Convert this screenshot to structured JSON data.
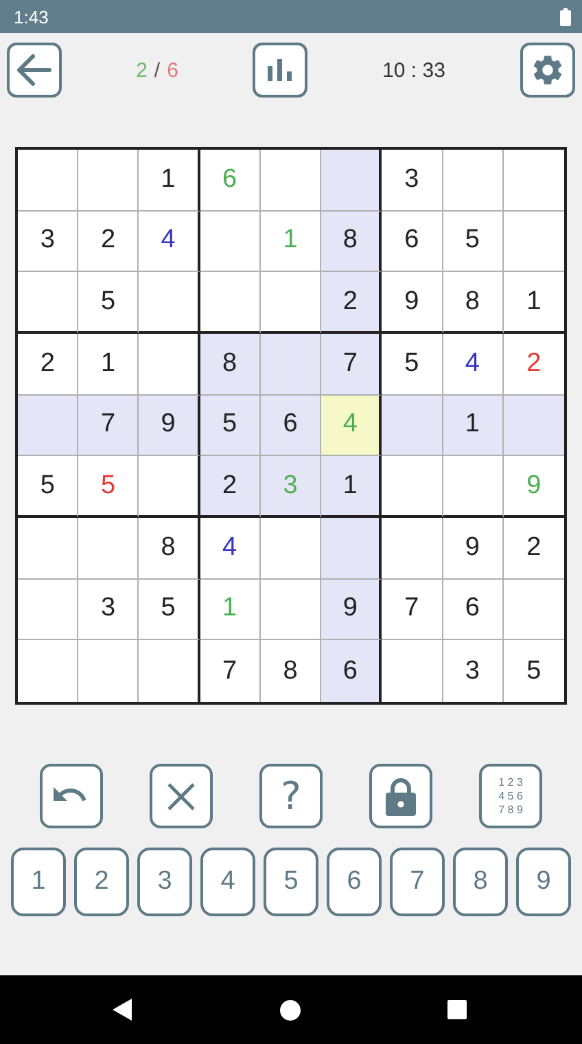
{
  "status_bar": {
    "time": "1:43"
  },
  "header": {
    "correct": "2",
    "separator": "/",
    "mistakes": "6",
    "timer": "10 : 33"
  },
  "grid": [
    [
      {
        "highlighted": false,
        "selected": false
      },
      {
        "highlighted": false,
        "selected": false
      },
      {
        "value": "1",
        "kind": "given",
        "highlighted": false,
        "selected": false
      },
      {
        "value": "6",
        "kind": "correct",
        "highlighted": false,
        "selected": false
      },
      {
        "highlighted": false,
        "selected": false
      },
      {
        "highlighted": true,
        "selected": false
      },
      {
        "value": "3",
        "kind": "given",
        "highlighted": false,
        "selected": false
      },
      {
        "highlighted": false,
        "selected": false
      },
      {
        "highlighted": false,
        "selected": false
      }
    ],
    [
      {
        "value": "3",
        "kind": "given",
        "highlighted": false,
        "selected": false
      },
      {
        "value": "2",
        "kind": "given",
        "highlighted": false,
        "selected": false
      },
      {
        "value": "4",
        "kind": "entered",
        "highlighted": false,
        "selected": false
      },
      {
        "highlighted": false,
        "selected": false
      },
      {
        "value": "1",
        "kind": "correct",
        "highlighted": false,
        "selected": false
      },
      {
        "value": "8",
        "kind": "given",
        "highlighted": true,
        "selected": false
      },
      {
        "value": "6",
        "kind": "given",
        "highlighted": false,
        "selected": false
      },
      {
        "value": "5",
        "kind": "given",
        "highlighted": false,
        "selected": false
      },
      {
        "highlighted": false,
        "selected": false
      }
    ],
    [
      {
        "highlighted": false,
        "selected": false
      },
      {
        "value": "5",
        "kind": "given",
        "highlighted": false,
        "selected": false
      },
      {
        "highlighted": false,
        "selected": false
      },
      {
        "highlighted": false,
        "selected": false
      },
      {
        "highlighted": false,
        "selected": false
      },
      {
        "value": "2",
        "kind": "given",
        "highlighted": true,
        "selected": false
      },
      {
        "value": "9",
        "kind": "given",
        "highlighted": false,
        "selected": false
      },
      {
        "value": "8",
        "kind": "given",
        "highlighted": false,
        "selected": false
      },
      {
        "value": "1",
        "kind": "given",
        "highlighted": false,
        "selected": false
      }
    ],
    [
      {
        "value": "2",
        "kind": "given",
        "highlighted": false,
        "selected": false
      },
      {
        "value": "1",
        "kind": "given",
        "highlighted": false,
        "selected": false
      },
      {
        "highlighted": false,
        "selected": false
      },
      {
        "value": "8",
        "kind": "given",
        "highlighted": true,
        "selected": false
      },
      {
        "highlighted": true,
        "selected": false
      },
      {
        "value": "7",
        "kind": "given",
        "highlighted": true,
        "selected": false
      },
      {
        "value": "5",
        "kind": "given",
        "highlighted": false,
        "selected": false
      },
      {
        "value": "4",
        "kind": "entered",
        "highlighted": false,
        "selected": false
      },
      {
        "value": "2",
        "kind": "wrong",
        "highlighted": false,
        "selected": false
      }
    ],
    [
      {
        "highlighted": true,
        "selected": false
      },
      {
        "value": "7",
        "kind": "given",
        "highlighted": true,
        "selected": false
      },
      {
        "value": "9",
        "kind": "given",
        "highlighted": true,
        "selected": false
      },
      {
        "value": "5",
        "kind": "given",
        "highlighted": true,
        "selected": false
      },
      {
        "value": "6",
        "kind": "given",
        "highlighted": true,
        "selected": false
      },
      {
        "value": "4",
        "kind": "correct",
        "highlighted": true,
        "selected": true
      },
      {
        "highlighted": true,
        "selected": false
      },
      {
        "value": "1",
        "kind": "given",
        "highlighted": true,
        "selected": false
      },
      {
        "highlighted": true,
        "selected": false
      }
    ],
    [
      {
        "value": "5",
        "kind": "given",
        "highlighted": false,
        "selected": false
      },
      {
        "value": "5",
        "kind": "wrong",
        "highlighted": false,
        "selected": false
      },
      {
        "highlighted": false,
        "selected": false
      },
      {
        "value": "2",
        "kind": "given",
        "highlighted": true,
        "selected": false
      },
      {
        "value": "3",
        "kind": "correct",
        "highlighted": true,
        "selected": false
      },
      {
        "value": "1",
        "kind": "given",
        "highlighted": true,
        "selected": false
      },
      {
        "highlighted": false,
        "selected": false
      },
      {
        "highlighted": false,
        "selected": false
      },
      {
        "value": "9",
        "kind": "correct",
        "highlighted": false,
        "selected": false
      }
    ],
    [
      {
        "highlighted": false,
        "selected": false
      },
      {
        "highlighted": false,
        "selected": false
      },
      {
        "value": "8",
        "kind": "given",
        "highlighted": false,
        "selected": false
      },
      {
        "value": "4",
        "kind": "entered",
        "highlighted": false,
        "selected": false
      },
      {
        "highlighted": false,
        "selected": false
      },
      {
        "highlighted": true,
        "selected": false
      },
      {
        "highlighted": false,
        "selected": false
      },
      {
        "value": "9",
        "kind": "given",
        "highlighted": false,
        "selected": false
      },
      {
        "value": "2",
        "kind": "given",
        "highlighted": false,
        "selected": false
      }
    ],
    [
      {
        "highlighted": false,
        "selected": false
      },
      {
        "value": "3",
        "kind": "given",
        "highlighted": false,
        "selected": false
      },
      {
        "value": "5",
        "kind": "given",
        "highlighted": false,
        "selected": false
      },
      {
        "value": "1",
        "kind": "correct",
        "highlighted": false,
        "selected": false
      },
      {
        "highlighted": false,
        "selected": false
      },
      {
        "value": "9",
        "kind": "given",
        "highlighted": true,
        "selected": false
      },
      {
        "value": "7",
        "kind": "given",
        "highlighted": false,
        "selected": false
      },
      {
        "value": "6",
        "kind": "given",
        "highlighted": false,
        "selected": false
      },
      {
        "highlighted": false,
        "selected": false
      }
    ],
    [
      {
        "highlighted": false,
        "selected": false
      },
      {
        "highlighted": false,
        "selected": false
      },
      {
        "highlighted": false,
        "selected": false
      },
      {
        "value": "7",
        "kind": "given",
        "highlighted": false,
        "selected": false
      },
      {
        "value": "8",
        "kind": "given",
        "highlighted": false,
        "selected": false
      },
      {
        "value": "6",
        "kind": "given",
        "highlighted": true,
        "selected": false
      },
      {
        "highlighted": false,
        "selected": false
      },
      {
        "value": "3",
        "kind": "given",
        "highlighted": false,
        "selected": false
      },
      {
        "value": "5",
        "kind": "given",
        "highlighted": false,
        "selected": false
      }
    ]
  ],
  "tools": [
    {
      "kind": "undo"
    },
    {
      "kind": "erase"
    },
    {
      "kind": "hint",
      "label": "?"
    },
    {
      "kind": "lock"
    },
    {
      "kind": "notes",
      "digits": [
        "1",
        "2",
        "3",
        "4",
        "5",
        "6",
        "7",
        "8",
        "9"
      ]
    }
  ],
  "number_pad": [
    "1",
    "2",
    "3",
    "4",
    "5",
    "6",
    "7",
    "8",
    "9"
  ]
}
